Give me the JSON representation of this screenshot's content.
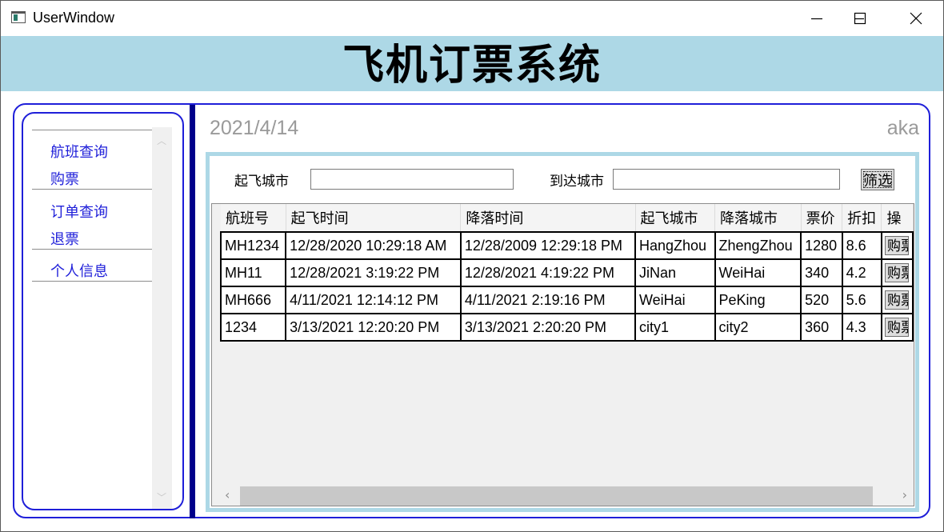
{
  "window": {
    "title": "UserWindow"
  },
  "header": {
    "title": "飞机订票系统"
  },
  "sidebar": {
    "items": [
      {
        "label": "航班查询"
      },
      {
        "label": "购票"
      },
      {
        "label": "订单查询"
      },
      {
        "label": "退票"
      },
      {
        "label": "个人信息"
      }
    ]
  },
  "main": {
    "date": "2021/4/14",
    "user": "aka",
    "filter": {
      "from_label": "起飞城市",
      "from_value": "",
      "to_label": "到达城市",
      "to_value": "",
      "button_label": "筛选"
    },
    "table": {
      "columns": [
        "航班号",
        "起飞时间",
        "降落时间",
        "起飞城市",
        "降落城市",
        "票价",
        "折扣",
        "操"
      ],
      "buy_label": "购票",
      "rows": [
        [
          "MH1234",
          "12/28/2020 10:29:18 AM",
          "12/28/2009 12:29:18 PM",
          "HangZhou",
          "ZhengZhou",
          "1280",
          "8.6"
        ],
        [
          "MH11",
          "12/28/2021 3:19:22 PM",
          "12/28/2021 4:19:22 PM",
          "JiNan",
          "WeiHai",
          "340",
          "4.2"
        ],
        [
          "MH666",
          "4/11/2021 12:14:12 PM",
          "4/11/2021 2:19:16 PM",
          "WeiHai",
          "PeKing",
          "520",
          "5.6"
        ],
        [
          "1234",
          "3/13/2021 12:20:20 PM",
          "3/13/2021 2:20:20 PM",
          "city1",
          "city2",
          "360",
          "4.3"
        ]
      ]
    }
  },
  "colors": {
    "banner": "#add8e6",
    "accent": "#1f1fd9",
    "divider": "#00008b",
    "muted_text": "#9a9a9a"
  }
}
